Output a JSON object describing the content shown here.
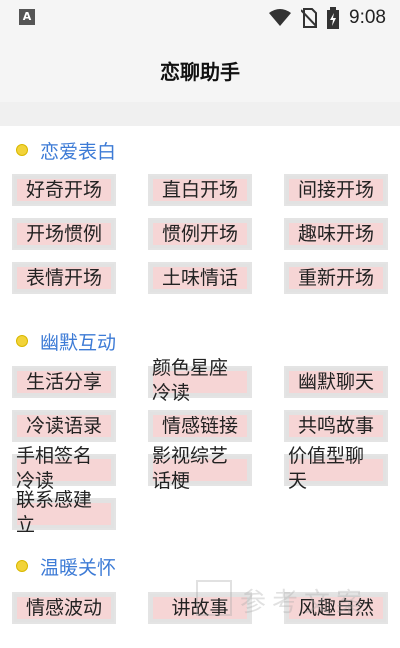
{
  "status_bar": {
    "left_icon": "A",
    "time": "9:08"
  },
  "header": {
    "title": "恋聊助手"
  },
  "sections": [
    {
      "title": "恋爱表白",
      "items": [
        "好奇开场",
        "直白开场",
        "间接开场",
        "开场惯例",
        "惯例开场",
        "趣味开场",
        "表情开场",
        "土味情话",
        "重新开场"
      ]
    },
    {
      "title": "幽默互动",
      "items": [
        "生活分享",
        "颜色星座冷读",
        "幽默聊天",
        "冷读语录",
        "情感链接",
        "共鸣故事",
        "手相签名冷读",
        "影视综艺话梗",
        "价值型聊天",
        "联系感建立"
      ]
    },
    {
      "title": "温暖关怀",
      "items": [
        "情感波动",
        "讲故事",
        "风趣自然"
      ]
    }
  ],
  "watermark": {
    "text": "参考文案"
  },
  "colors": {
    "accent": "#3d7bd6",
    "tag_bg": "#f6d5d5",
    "dot": "#f2d33a"
  }
}
